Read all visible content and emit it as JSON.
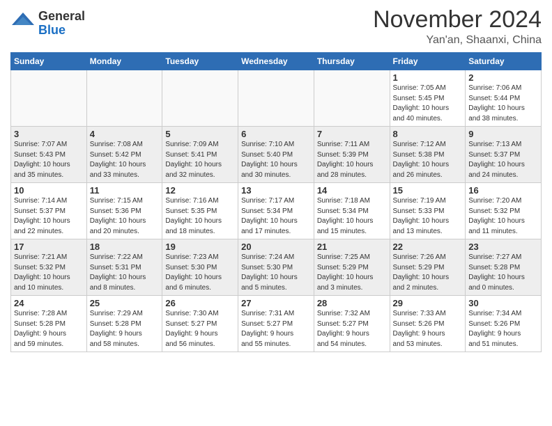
{
  "header": {
    "logo_general": "General",
    "logo_blue": "Blue",
    "month_title": "November 2024",
    "location": "Yan'an, Shaanxi, China"
  },
  "days_of_week": [
    "Sunday",
    "Monday",
    "Tuesday",
    "Wednesday",
    "Thursday",
    "Friday",
    "Saturday"
  ],
  "weeks": [
    {
      "days": [
        {
          "num": "",
          "info": ""
        },
        {
          "num": "",
          "info": ""
        },
        {
          "num": "",
          "info": ""
        },
        {
          "num": "",
          "info": ""
        },
        {
          "num": "",
          "info": ""
        },
        {
          "num": "1",
          "info": "Sunrise: 7:05 AM\nSunset: 5:45 PM\nDaylight: 10 hours\nand 40 minutes."
        },
        {
          "num": "2",
          "info": "Sunrise: 7:06 AM\nSunset: 5:44 PM\nDaylight: 10 hours\nand 38 minutes."
        }
      ]
    },
    {
      "days": [
        {
          "num": "3",
          "info": "Sunrise: 7:07 AM\nSunset: 5:43 PM\nDaylight: 10 hours\nand 35 minutes."
        },
        {
          "num": "4",
          "info": "Sunrise: 7:08 AM\nSunset: 5:42 PM\nDaylight: 10 hours\nand 33 minutes."
        },
        {
          "num": "5",
          "info": "Sunrise: 7:09 AM\nSunset: 5:41 PM\nDaylight: 10 hours\nand 32 minutes."
        },
        {
          "num": "6",
          "info": "Sunrise: 7:10 AM\nSunset: 5:40 PM\nDaylight: 10 hours\nand 30 minutes."
        },
        {
          "num": "7",
          "info": "Sunrise: 7:11 AM\nSunset: 5:39 PM\nDaylight: 10 hours\nand 28 minutes."
        },
        {
          "num": "8",
          "info": "Sunrise: 7:12 AM\nSunset: 5:38 PM\nDaylight: 10 hours\nand 26 minutes."
        },
        {
          "num": "9",
          "info": "Sunrise: 7:13 AM\nSunset: 5:37 PM\nDaylight: 10 hours\nand 24 minutes."
        }
      ]
    },
    {
      "days": [
        {
          "num": "10",
          "info": "Sunrise: 7:14 AM\nSunset: 5:37 PM\nDaylight: 10 hours\nand 22 minutes."
        },
        {
          "num": "11",
          "info": "Sunrise: 7:15 AM\nSunset: 5:36 PM\nDaylight: 10 hours\nand 20 minutes."
        },
        {
          "num": "12",
          "info": "Sunrise: 7:16 AM\nSunset: 5:35 PM\nDaylight: 10 hours\nand 18 minutes."
        },
        {
          "num": "13",
          "info": "Sunrise: 7:17 AM\nSunset: 5:34 PM\nDaylight: 10 hours\nand 17 minutes."
        },
        {
          "num": "14",
          "info": "Sunrise: 7:18 AM\nSunset: 5:34 PM\nDaylight: 10 hours\nand 15 minutes."
        },
        {
          "num": "15",
          "info": "Sunrise: 7:19 AM\nSunset: 5:33 PM\nDaylight: 10 hours\nand 13 minutes."
        },
        {
          "num": "16",
          "info": "Sunrise: 7:20 AM\nSunset: 5:32 PM\nDaylight: 10 hours\nand 11 minutes."
        }
      ]
    },
    {
      "days": [
        {
          "num": "17",
          "info": "Sunrise: 7:21 AM\nSunset: 5:32 PM\nDaylight: 10 hours\nand 10 minutes."
        },
        {
          "num": "18",
          "info": "Sunrise: 7:22 AM\nSunset: 5:31 PM\nDaylight: 10 hours\nand 8 minutes."
        },
        {
          "num": "19",
          "info": "Sunrise: 7:23 AM\nSunset: 5:30 PM\nDaylight: 10 hours\nand 6 minutes."
        },
        {
          "num": "20",
          "info": "Sunrise: 7:24 AM\nSunset: 5:30 PM\nDaylight: 10 hours\nand 5 minutes."
        },
        {
          "num": "21",
          "info": "Sunrise: 7:25 AM\nSunset: 5:29 PM\nDaylight: 10 hours\nand 3 minutes."
        },
        {
          "num": "22",
          "info": "Sunrise: 7:26 AM\nSunset: 5:29 PM\nDaylight: 10 hours\nand 2 minutes."
        },
        {
          "num": "23",
          "info": "Sunrise: 7:27 AM\nSunset: 5:28 PM\nDaylight: 10 hours\nand 0 minutes."
        }
      ]
    },
    {
      "days": [
        {
          "num": "24",
          "info": "Sunrise: 7:28 AM\nSunset: 5:28 PM\nDaylight: 9 hours\nand 59 minutes."
        },
        {
          "num": "25",
          "info": "Sunrise: 7:29 AM\nSunset: 5:28 PM\nDaylight: 9 hours\nand 58 minutes."
        },
        {
          "num": "26",
          "info": "Sunrise: 7:30 AM\nSunset: 5:27 PM\nDaylight: 9 hours\nand 56 minutes."
        },
        {
          "num": "27",
          "info": "Sunrise: 7:31 AM\nSunset: 5:27 PM\nDaylight: 9 hours\nand 55 minutes."
        },
        {
          "num": "28",
          "info": "Sunrise: 7:32 AM\nSunset: 5:27 PM\nDaylight: 9 hours\nand 54 minutes."
        },
        {
          "num": "29",
          "info": "Sunrise: 7:33 AM\nSunset: 5:26 PM\nDaylight: 9 hours\nand 53 minutes."
        },
        {
          "num": "30",
          "info": "Sunrise: 7:34 AM\nSunset: 5:26 PM\nDaylight: 9 hours\nand 51 minutes."
        }
      ]
    }
  ]
}
